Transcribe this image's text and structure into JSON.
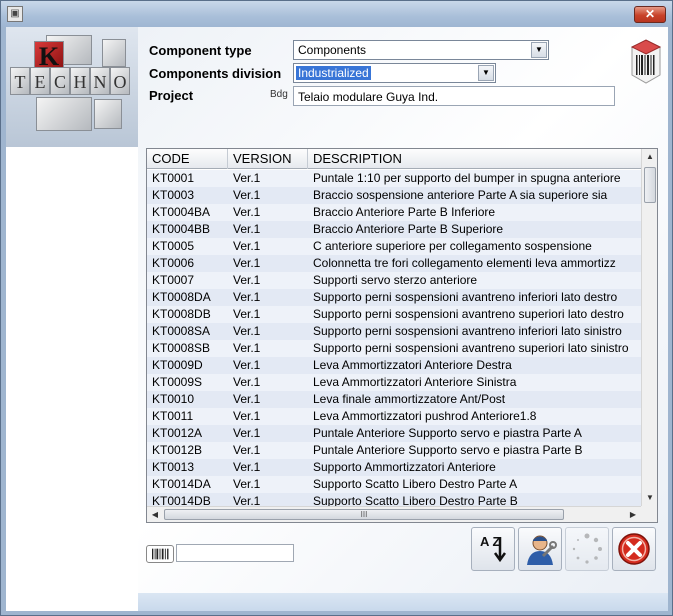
{
  "window": {
    "close_glyph": "✕",
    "app_icon": "app-icon"
  },
  "logo": {
    "letters": [
      "K",
      "T",
      "E",
      "C",
      "H",
      "N",
      "O"
    ],
    "accent": "#c82222"
  },
  "form": {
    "component_type": {
      "label": "Component type",
      "value": "Components"
    },
    "components_division": {
      "label": "Components division",
      "value": "Industrialized"
    },
    "project": {
      "label": "Project",
      "tag": "Bdg",
      "value": "Telaio modulare Guya Ind."
    }
  },
  "grid": {
    "columns": [
      "CODE",
      "VERSION",
      "DESCRIPTION"
    ],
    "rows": [
      [
        "KT0001",
        "Ver.1",
        "Puntale 1:10 per supporto del bumper in spugna anteriore"
      ],
      [
        "KT0003",
        "Ver.1",
        "Braccio sospensione anteriore Parte A sia superiore sia"
      ],
      [
        "KT0004BA",
        "Ver.1",
        "Braccio Anteriore Parte B Inferiore"
      ],
      [
        "KT0004BB",
        "Ver.1",
        "Braccio Anteriore Parte B Superiore"
      ],
      [
        "KT0005",
        "Ver.1",
        "C anteriore superiore per collegamento sospensione"
      ],
      [
        "KT0006",
        "Ver.1",
        "Colonnetta tre fori collegamento elementi leva ammortizz"
      ],
      [
        "KT0007",
        "Ver.1",
        "Supporti servo sterzo anteriore"
      ],
      [
        "KT0008DA",
        "Ver.1",
        "Supporto perni sospensioni avantreno inferiori lato destro"
      ],
      [
        "KT0008DB",
        "Ver.1",
        "Supporto perni sospensioni avantreno superiori lato destro"
      ],
      [
        "KT0008SA",
        "Ver.1",
        "Supporto perni sospensioni avantreno inferiori lato sinistro"
      ],
      [
        "KT0008SB",
        "Ver.1",
        "Supporto perni sospensioni avantreno superiori lato sinistro"
      ],
      [
        "KT0009D",
        "Ver.1",
        "Leva Ammortizzatori Anteriore Destra"
      ],
      [
        "KT0009S",
        "Ver.1",
        "Leva Ammortizzatori Anteriore Sinistra"
      ],
      [
        "KT0010",
        "Ver.1",
        "Leva finale ammortizzatore Ant/Post"
      ],
      [
        "KT0011",
        "Ver.1",
        "Leva Ammortizzatori pushrod Anteriore1.8"
      ],
      [
        "KT0012A",
        "Ver.1",
        "Puntale Anteriore Supporto servo e piastra Parte A"
      ],
      [
        "KT0012B",
        "Ver.1",
        "Puntale Anteriore Supporto servo e piastra Parte B"
      ],
      [
        "KT0013",
        "Ver.1",
        "Supporto Ammortizzatori Anteriore"
      ],
      [
        "KT0014DA",
        "Ver.1",
        "Supporto Scatto Libero Destro Parte A"
      ],
      [
        "KT0014DB",
        "Ver.1",
        "Supporto Scatto Libero Destro Parte B"
      ]
    ],
    "hscroll_grip": "III"
  },
  "barcode": {
    "value": ""
  },
  "toolbar": {
    "sort_icon": "sort-az-icon",
    "sort_text": "A Z",
    "user_icon": "technician-icon",
    "busy_icon": "spinner-icon",
    "exit_icon": "exit-icon"
  },
  "colors": {
    "selection": "#3875d7",
    "row_alt": "#e3e9f4",
    "exit_red": "#d42b1e"
  }
}
